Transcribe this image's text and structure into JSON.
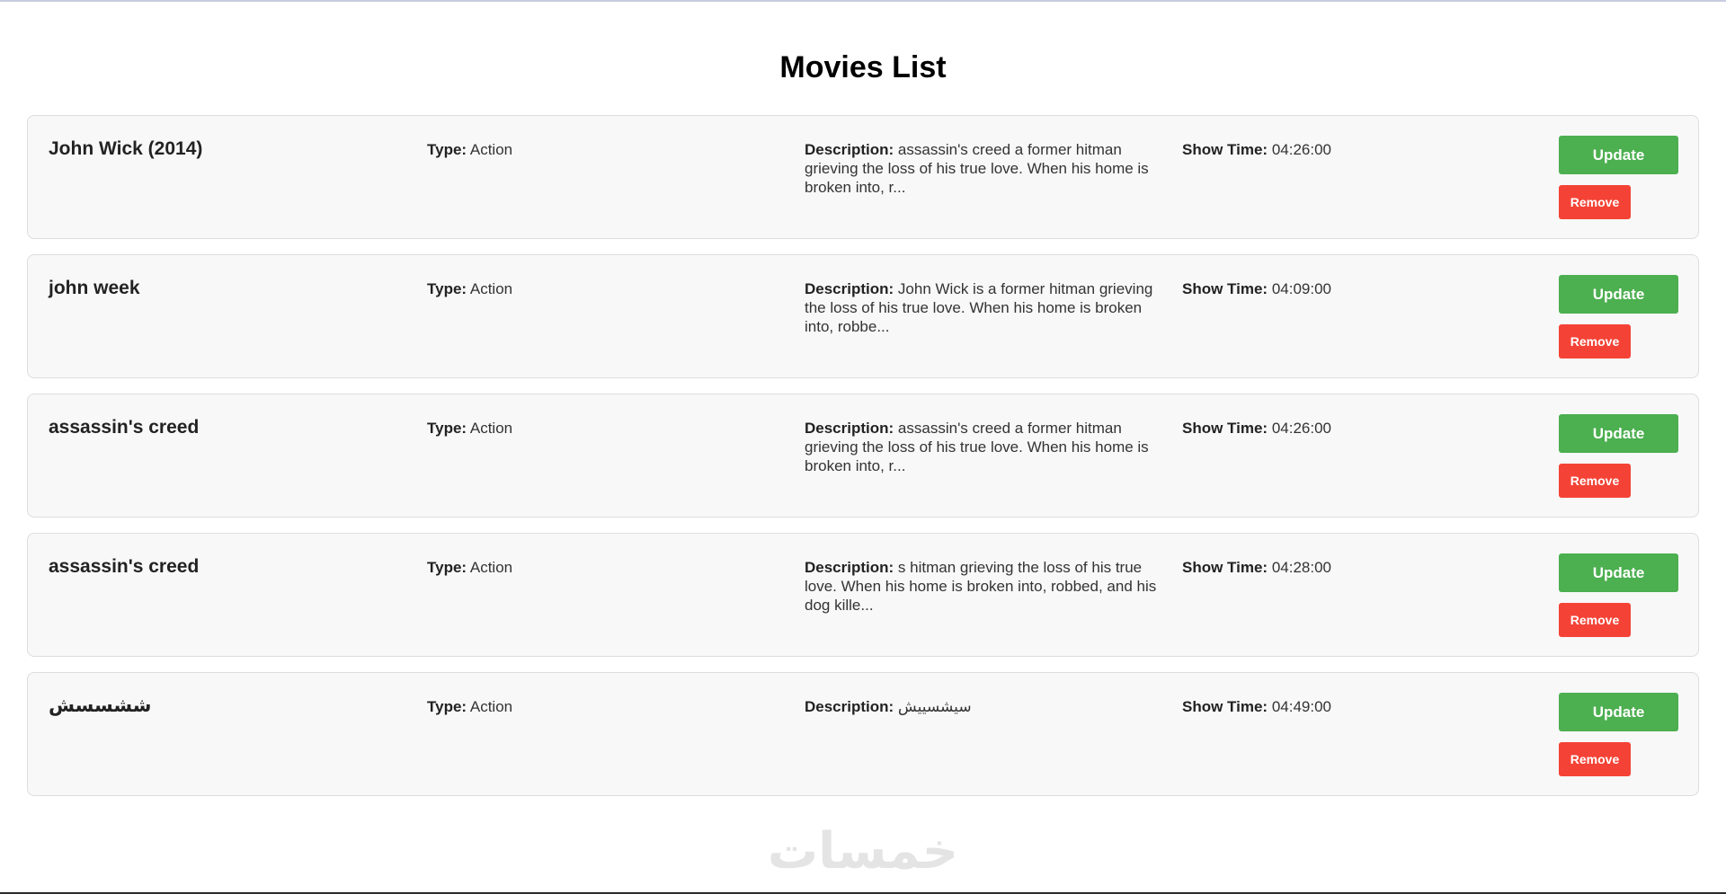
{
  "page": {
    "title": "Movies List"
  },
  "labels": {
    "type": "Type:",
    "description": "Description:",
    "show_time": "Show Time:"
  },
  "movies": [
    {
      "title": "John Wick (2014)",
      "type": "Action",
      "description": "assassin's creed a former hitman grieving the loss of his true love. When his home is broken into, r...",
      "show_time": "04:26:00",
      "update_label": "Update",
      "remove_label": "Remove"
    },
    {
      "title": "john week",
      "type": "Action",
      "description": "John Wick is a former hitman grieving the loss of his true love. When his home is broken into, robbe...",
      "show_time": "04:09:00",
      "update_label": "Update",
      "remove_label": "Remove"
    },
    {
      "title": "assassin's creed",
      "type": "Action",
      "description": "assassin's creed a former hitman grieving the loss of his true love. When his home is broken into, r...",
      "show_time": "04:26:00",
      "update_label": "Update",
      "remove_label": "Remove"
    },
    {
      "title": "assassin's creed",
      "type": "Action",
      "description": "s hitman grieving the loss of his true love. When his home is broken into, robbed, and his dog kille...",
      "show_time": "04:28:00",
      "update_label": "Update",
      "remove_label": "Remove"
    },
    {
      "title": "ششسسش",
      "type": "Action",
      "description": "سيشسييش",
      "show_time": "04:49:00",
      "update_label": "Update",
      "remove_label": "Remove"
    }
  ],
  "watermark": {
    "text": "خمسات"
  },
  "colors": {
    "update_button": "#4caf50",
    "remove_button": "#f44336",
    "card_background": "#f8f8f8",
    "card_border": "#dddddd"
  }
}
